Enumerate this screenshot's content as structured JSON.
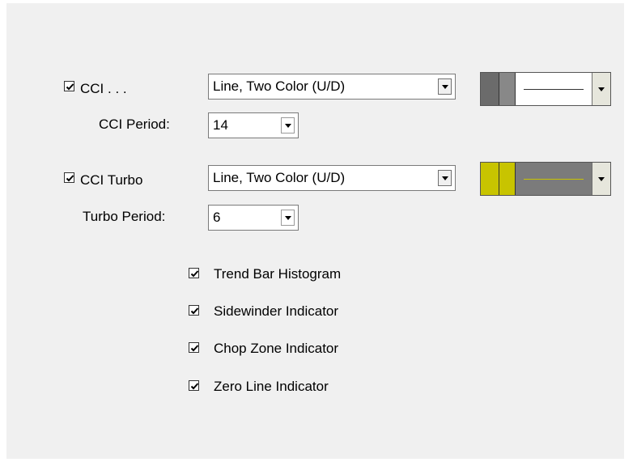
{
  "colors": {
    "panel_bg": "#f0f0f0",
    "cci_up": "#6b6b6b",
    "cci_down": "#888888",
    "cci_preview_bg": "#ffffff",
    "cci_preview_line": "#333333",
    "turbo_up": "#c8c400",
    "turbo_down": "#c8c400",
    "turbo_preview_bg": "#7b7b7b",
    "turbo_preview_line": "#c8c400"
  },
  "cci": {
    "checked": true,
    "label": "CCI . . .",
    "style_value": "Line, Two Color (U/D)",
    "period_label": "CCI Period:",
    "period_value": "14"
  },
  "turbo": {
    "checked": true,
    "label": "CCI Turbo",
    "style_value": "Line, Two Color (U/D)",
    "period_label": "Turbo Period:",
    "period_value": "6"
  },
  "options": [
    {
      "label": "Trend Bar Histogram",
      "checked": true
    },
    {
      "label": "Sidewinder Indicator",
      "checked": true
    },
    {
      "label": "Chop Zone Indicator",
      "checked": true
    },
    {
      "label": "Zero Line Indicator",
      "checked": true
    }
  ]
}
